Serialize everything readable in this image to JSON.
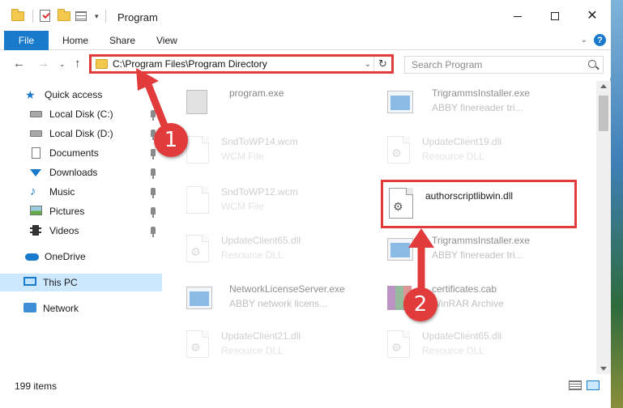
{
  "window": {
    "title": "Program"
  },
  "ribbon": {
    "tabs": [
      "File",
      "Home",
      "Share",
      "View"
    ]
  },
  "address": {
    "path": "C:\\Program Files\\Program Directory"
  },
  "search": {
    "placeholder": "Search Program"
  },
  "nav": {
    "items": [
      {
        "label": "Quick access",
        "icon": "quick-access-star-icon"
      },
      {
        "label": "Local Disk (C:)",
        "icon": "local-disk-icon",
        "pinned": true
      },
      {
        "label": "Local Disk (D:)",
        "icon": "local-disk-icon",
        "pinned": true
      },
      {
        "label": "Documents",
        "icon": "documents-icon",
        "pinned": true
      },
      {
        "label": "Downloads",
        "icon": "downloads-icon",
        "pinned": true
      },
      {
        "label": "Music",
        "icon": "music-icon",
        "pinned": true
      },
      {
        "label": "Pictures",
        "icon": "pictures-icon",
        "pinned": true
      },
      {
        "label": "Videos",
        "icon": "videos-icon",
        "pinned": true
      },
      {
        "label": "OneDrive",
        "icon": "onedrive-cloud-icon"
      },
      {
        "label": "This PC",
        "icon": "this-pc-icon",
        "selected": true
      },
      {
        "label": "Network",
        "icon": "network-icon"
      }
    ]
  },
  "files": [
    {
      "name": "program.exe",
      "type": "",
      "icon": "setup-icon"
    },
    {
      "name": "TrigrammsInstaller.exe",
      "type": "ABBY finereader tri...",
      "icon": "exe-icon"
    },
    {
      "name": "SndToWP14.wcm",
      "type": "WCM File",
      "icon": "file-icon"
    },
    {
      "name": "UpdateClient19.dll",
      "type": "Resource DLL",
      "icon": "dll-icon"
    },
    {
      "name": "SndToWP12.wcm",
      "type": "WCM File",
      "icon": "file-icon"
    },
    {
      "name": "authorscriptlibwin.dll",
      "type": "",
      "icon": "dll-icon"
    },
    {
      "name": "UpdateClient65.dll",
      "type": "Resource DLL",
      "icon": "dll-icon"
    },
    {
      "name": "TrigrammsInstaller.exe",
      "type": "ABBY finereader tri...",
      "icon": "exe-icon"
    },
    {
      "name": "NetworkLicenseServer.exe",
      "type": "ABBY network licens...",
      "icon": "exe-icon"
    },
    {
      "name": "certificates.cab",
      "type": "WinRAR Archive",
      "icon": "cab-icon"
    },
    {
      "name": "UpdateClient21.dll",
      "type": "Resource DLL",
      "icon": "dll-icon"
    },
    {
      "name": "UpdateClient65.dll",
      "type": "Resource DLL",
      "icon": "dll-icon"
    }
  ],
  "status": {
    "item_count": "199 items"
  },
  "annotations": {
    "step1": "1",
    "step2": "2",
    "color": "#e23b3b"
  },
  "colors": {
    "accent": "#1979ca",
    "selection": "#cce8ff"
  }
}
